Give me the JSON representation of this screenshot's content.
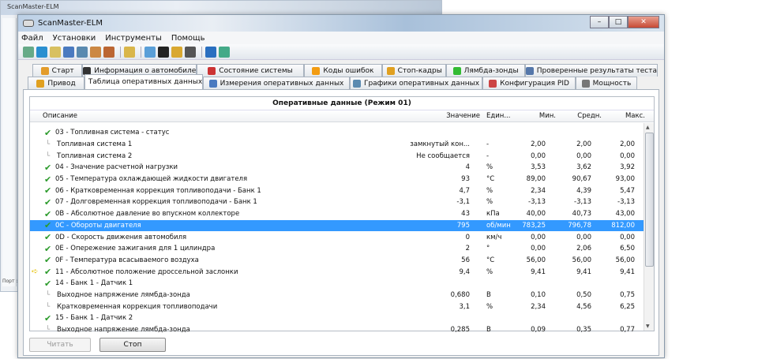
{
  "background_window": {
    "title": "ScanMaster-ELM",
    "status": "Порт :"
  },
  "window": {
    "title": "ScanMaster-ELM"
  },
  "menu": [
    "Файл",
    "Установки",
    "Инструменты",
    "Помощь"
  ],
  "toolbar_icons": [
    "connect-icon",
    "globe-icon",
    "document-icon",
    "grid-icon",
    "chart-icon",
    "flag-icon",
    "person-icon",
    "clipboard-icon",
    "chat-icon",
    "terminal-icon",
    "battery-icon",
    "gauge-icon",
    "info-icon",
    "exit-icon"
  ],
  "tabs_row1": [
    "Старт",
    "Информация о автомобиле",
    "Состояние системы",
    "Коды ошибок",
    "Стоп-кадры",
    "Лямбда-зонды",
    "Проверенные результаты теста"
  ],
  "tabs_row2": [
    "Привод",
    "Таблица оперативных данных",
    "Измерения оперативных данных",
    "Графики оперативных данных",
    "Конфигурация PID",
    "Мощность"
  ],
  "active_tab": "Таблица оперативных данных",
  "group_title": "Оперативные данные (Режим 01)",
  "columns": {
    "desc": "Описание",
    "value": "Значение",
    "unit": "Един...",
    "min": "Мин.",
    "avg": "Средн.",
    "max": "Макс."
  },
  "rows": [
    {
      "desc": "03 - Топливная система - статус",
      "check": true,
      "value": "",
      "unit": "",
      "min": "",
      "avg": "",
      "max": ""
    },
    {
      "desc": "Топливная система 1",
      "child": true,
      "value": "замкнутый кон...",
      "unit": "-",
      "min": "2,00",
      "avg": "2,00",
      "max": "2,00"
    },
    {
      "desc": "Топливная система 2",
      "child": true,
      "value": "Не сообщается",
      "unit": "-",
      "min": "0,00",
      "avg": "0,00",
      "max": "0,00"
    },
    {
      "desc": "04 - Значение расчетной нагрузки",
      "check": true,
      "value": "4",
      "unit": "%",
      "min": "3,53",
      "avg": "3,62",
      "max": "3,92"
    },
    {
      "desc": "05 - Температура охлаждающей жидкости двигателя",
      "check": true,
      "value": "93",
      "unit": "°C",
      "min": "89,00",
      "avg": "90,67",
      "max": "93,00"
    },
    {
      "desc": "06 - Кратковременная коррекция топливоподачи - Банк 1",
      "check": true,
      "value": "4,7",
      "unit": "%",
      "min": "2,34",
      "avg": "4,39",
      "max": "5,47"
    },
    {
      "desc": "07 - Долговременная коррекция топливоподачи - Банк 1",
      "check": true,
      "value": "-3,1",
      "unit": "%",
      "min": "-3,13",
      "avg": "-3,13",
      "max": "-3,13"
    },
    {
      "desc": "0B - Абсолютное давление во впускном коллекторе",
      "check": true,
      "value": "43",
      "unit": "кПа",
      "min": "40,00",
      "avg": "40,73",
      "max": "43,00"
    },
    {
      "desc": "0C - Обороты двигателя",
      "check": true,
      "selected": true,
      "value": "795",
      "unit": "об/мин",
      "min": "783,25",
      "avg": "796,78",
      "max": "812,00"
    },
    {
      "desc": "0D - Скорость движения автомобиля",
      "check": true,
      "value": "0",
      "unit": "км/ч",
      "min": "0,00",
      "avg": "0,00",
      "max": "0,00"
    },
    {
      "desc": "0E - Опережение зажигания для 1 цилиндра",
      "check": true,
      "value": "2",
      "unit": "°",
      "min": "0,00",
      "avg": "2,06",
      "max": "6,50"
    },
    {
      "desc": "0F - Температура всасываемого воздуха",
      "check": true,
      "value": "56",
      "unit": "°C",
      "min": "56,00",
      "avg": "56,00",
      "max": "56,00"
    },
    {
      "desc": "11 - Абсолютное положение дроссельной заслонки",
      "check": true,
      "arrow": true,
      "value": "9,4",
      "unit": "%",
      "min": "9,41",
      "avg": "9,41",
      "max": "9,41"
    },
    {
      "desc": "14 - Банк 1 - Датчик 1",
      "check": true,
      "value": "",
      "unit": "",
      "min": "",
      "avg": "",
      "max": ""
    },
    {
      "desc": "Выходное напряжение лямбда-зонда",
      "child": true,
      "value": "0,680",
      "unit": "В",
      "min": "0,10",
      "avg": "0,50",
      "max": "0,75"
    },
    {
      "desc": "Кратковременная коррекция топливоподачи",
      "child": true,
      "value": "3,1",
      "unit": "%",
      "min": "2,34",
      "avg": "4,56",
      "max": "6,25"
    },
    {
      "desc": "15 - Банк 1 - Датчик 2",
      "check": true,
      "value": "",
      "unit": "",
      "min": "",
      "avg": "",
      "max": ""
    },
    {
      "desc": "Выходное напряжение лямбда-зонда",
      "child": true,
      "value": "0,285",
      "unit": "В",
      "min": "0,09",
      "avg": "0,35",
      "max": "0,77"
    }
  ],
  "buttons": {
    "read": "Читать",
    "stop": "Стоп"
  },
  "colors": {
    "selection": "#3399ff",
    "check": "#2a9a2a"
  }
}
